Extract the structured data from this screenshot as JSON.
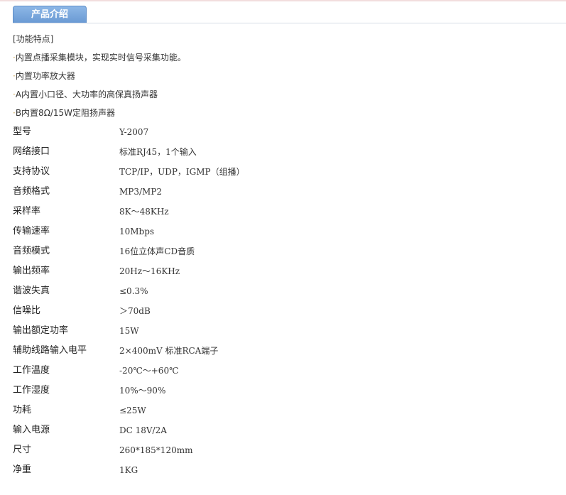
{
  "tab": {
    "label": "产品介绍"
  },
  "features": {
    "heading": "[功能特点]",
    "items": [
      {
        "marker": "·",
        "text": "内置点播采集模块，实现实时信号采集功能。"
      },
      {
        "marker": "·",
        "text": "内置功率放大器"
      },
      {
        "marker": "·",
        "text": "A内置小口径、大功率的高保真扬声器"
      },
      {
        "marker": "·",
        "text": "B内置8Ω/15W定阻扬声器"
      }
    ]
  },
  "specs": [
    {
      "label": "型号",
      "value": "Y-2007"
    },
    {
      "label": "网络接口",
      "value": "标准RJ45，1个输入"
    },
    {
      "label": "支持协议",
      "value": "TCP/IP，UDP，IGMP（组播）"
    },
    {
      "label": "音频格式",
      "value": "MP3/MP2"
    },
    {
      "label": "采样率",
      "value": "8K～48KHz"
    },
    {
      "label": "传输速率",
      "value": "10Mbps"
    },
    {
      "label": "音频模式",
      "value": "16位立体声CD音质"
    },
    {
      "label": "输出频率",
      "value": "20Hz～16KHz"
    },
    {
      "label": "谐波失真",
      "value": "≤0.3%"
    },
    {
      "label": "信噪比",
      "value": "＞70dB"
    },
    {
      "label": "输出额定功率",
      "value": "15W"
    },
    {
      "label": "辅助线路输入电平",
      "value": "2×400mV 标准RCA端子"
    },
    {
      "label": "工作温度",
      "value": "-20℃～+60℃"
    },
    {
      "label": "工作湿度",
      "value": "10%～90%"
    },
    {
      "label": "功耗",
      "value": "≤25W"
    },
    {
      "label": "输入电源",
      "value": "DC 18V/2A"
    },
    {
      "label": "尺寸",
      "value": "260*185*120mm"
    },
    {
      "label": "净重",
      "value": "1KG"
    }
  ]
}
